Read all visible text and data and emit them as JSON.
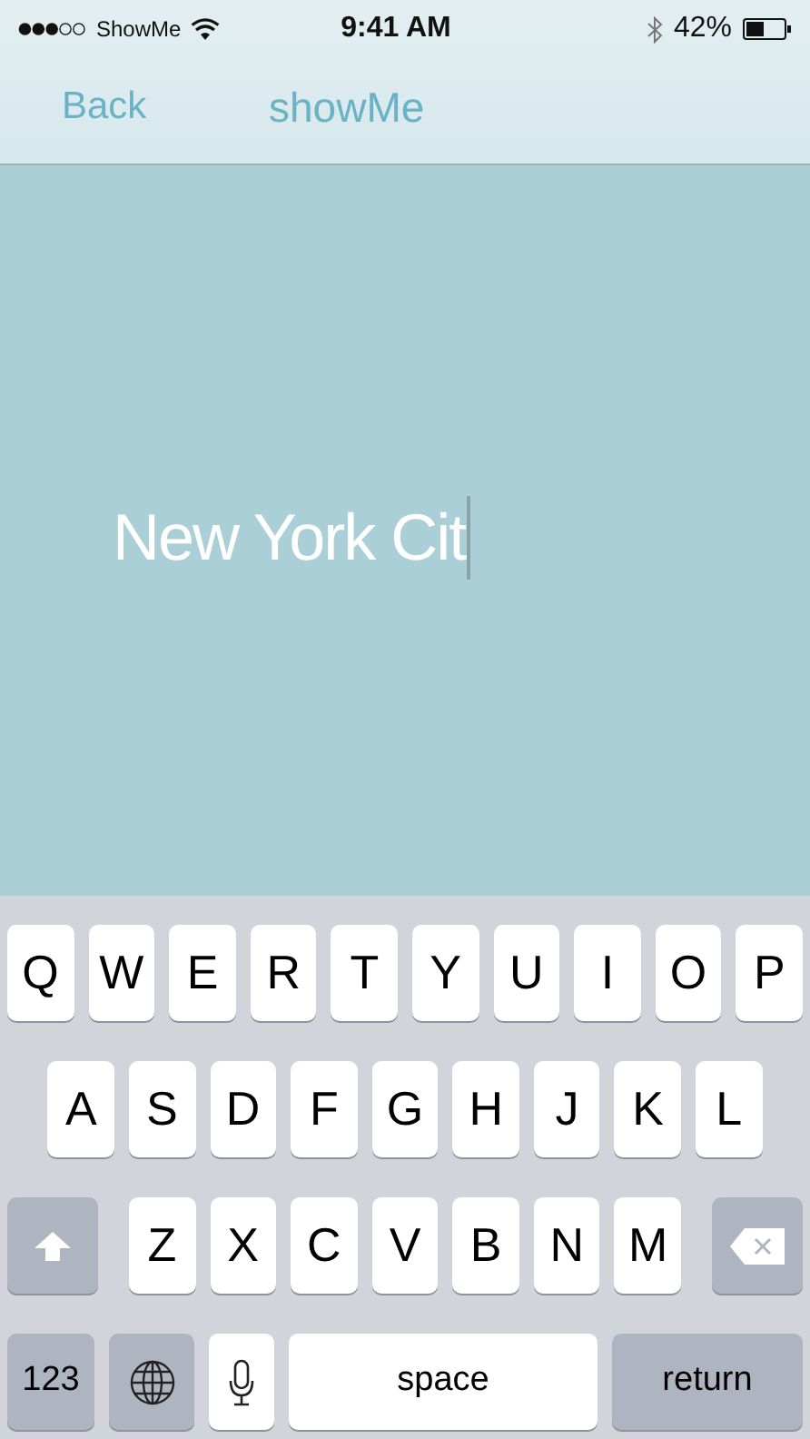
{
  "status_bar": {
    "carrier": "ShowMe",
    "time": "9:41 AM",
    "battery": "42%"
  },
  "nav_bar": {
    "back": "Back",
    "title": "showMe"
  },
  "search_field": {
    "value": "New York Cit",
    "focused": true
  },
  "keyboard": {
    "rows": [
      {
        "keys": [
          {
            "kind": "letter",
            "label": "Q"
          },
          {
            "kind": "letter",
            "label": "W"
          },
          {
            "kind": "letter",
            "label": "E"
          },
          {
            "kind": "letter",
            "label": "R"
          },
          {
            "kind": "letter",
            "label": "T"
          },
          {
            "kind": "letter",
            "label": "Y"
          },
          {
            "kind": "letter",
            "label": "U"
          },
          {
            "kind": "letter",
            "label": "I"
          },
          {
            "kind": "letter",
            "label": "O"
          },
          {
            "kind": "letter",
            "label": "P"
          }
        ]
      },
      {
        "keys": [
          {
            "kind": "letter",
            "label": "A"
          },
          {
            "kind": "letter",
            "label": "S"
          },
          {
            "kind": "letter",
            "label": "D"
          },
          {
            "kind": "letter",
            "label": "F"
          },
          {
            "kind": "letter",
            "label": "G"
          },
          {
            "kind": "letter",
            "label": "H"
          },
          {
            "kind": "letter",
            "label": "J"
          },
          {
            "kind": "letter",
            "label": "K"
          },
          {
            "kind": "letter",
            "label": "L"
          }
        ]
      },
      {
        "keys": [
          {
            "kind": "shift"
          },
          {
            "kind": "letter",
            "label": "Z"
          },
          {
            "kind": "letter",
            "label": "X"
          },
          {
            "kind": "letter",
            "label": "C"
          },
          {
            "kind": "letter",
            "label": "V"
          },
          {
            "kind": "letter",
            "label": "B"
          },
          {
            "kind": "letter",
            "label": "N"
          },
          {
            "kind": "letter",
            "label": "M"
          },
          {
            "kind": "delete"
          }
        ]
      },
      {
        "keys": [
          {
            "kind": "numbers",
            "label": "123"
          },
          {
            "kind": "globe"
          },
          {
            "kind": "mic"
          },
          {
            "kind": "space",
            "label": "space"
          },
          {
            "kind": "return",
            "label": "return"
          }
        ]
      }
    ]
  }
}
